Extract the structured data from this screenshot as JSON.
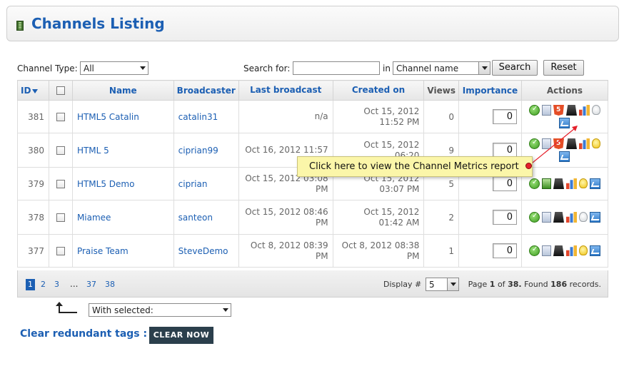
{
  "page": {
    "title": "Channels Listing"
  },
  "filters": {
    "channel_type_label": "Channel Type:",
    "channel_type_value": "All",
    "search_label": "Search for:",
    "search_value": "",
    "in_label": "in",
    "search_field_value": "Channel name",
    "search_button": "Search",
    "reset_button": "Reset"
  },
  "table": {
    "columns": [
      "ID",
      "",
      "Name",
      "Broadcaster",
      "Last broadcast",
      "Created on",
      "Views",
      "Importance",
      "Actions"
    ],
    "rows": [
      {
        "id": "381",
        "name": "HTML5 Catalin",
        "broadcaster": "catalin31",
        "last_broadcast": "n/a",
        "created_on": "Oct 15, 2012 11:52 PM",
        "views": "0",
        "importance": "0",
        "icons": [
          "status-ok-icon",
          "document-icon",
          "html5-icon",
          "stand-icon",
          "stats-icon",
          "bulb-off-icon",
          "metrics-icon"
        ]
      },
      {
        "id": "380",
        "name": "HTML 5",
        "broadcaster": "ciprian99",
        "last_broadcast": "Oct 16, 2012 11:57",
        "created_on": "Oct 15, 2012 06:20",
        "views": "9",
        "importance": "0",
        "icons": [
          "status-ok-icon",
          "document-icon",
          "html5-icon",
          "stand-icon",
          "stats-icon",
          "bulb-on-icon",
          "metrics-icon"
        ]
      },
      {
        "id": "379",
        "name": "HTML5 Demo",
        "broadcaster": "ciprian",
        "last_broadcast": "Oct 15, 2012 03:08 PM",
        "created_on": "Oct 15, 2012 03:07 PM",
        "views": "5",
        "importance": "0",
        "icons": [
          "status-ok-icon",
          "monitor-icon",
          "stand-icon",
          "stats-icon",
          "bulb-on-icon",
          "metrics-icon"
        ]
      },
      {
        "id": "378",
        "name": "Miamee",
        "broadcaster": "santeon",
        "last_broadcast": "Oct 15, 2012 08:46 PM",
        "created_on": "Oct 15, 2012 01:42 AM",
        "views": "2",
        "importance": "0",
        "icons": [
          "status-ok-icon",
          "document-icon",
          "stand-icon",
          "stats-icon",
          "bulb-off-icon",
          "metrics-icon"
        ]
      },
      {
        "id": "377",
        "name": "Praise Team",
        "broadcaster": "SteveDemo",
        "last_broadcast": "Oct 8, 2012 08:39 PM",
        "created_on": "Oct 8, 2012 08:38 PM",
        "views": "1",
        "importance": "0",
        "icons": [
          "status-ok-icon",
          "document-icon",
          "stand-icon",
          "stats-icon",
          "bulb-on-icon",
          "metrics-icon"
        ]
      }
    ]
  },
  "pagination": {
    "pages": [
      "1",
      "2",
      "3",
      "...",
      "37",
      "38"
    ],
    "current": "1",
    "display_label": "Display #",
    "display_value": "5",
    "page_word": "Page",
    "page_current": "1",
    "of_word": "of",
    "page_total": "38.",
    "found_word": "Found",
    "found_count": "186",
    "records_word": "records."
  },
  "bulk": {
    "with_selected": "With selected:"
  },
  "clear": {
    "label": "Clear redundant tags :",
    "button": "CLEAR NOW"
  },
  "tooltip": {
    "text": "Click here to view the Channel Metrics report",
    "color": "#fbf6a9",
    "marker_color": "#e5202b"
  },
  "colors": {
    "accent": "#1c5fb3",
    "button_dark": "#2b3f4c"
  }
}
